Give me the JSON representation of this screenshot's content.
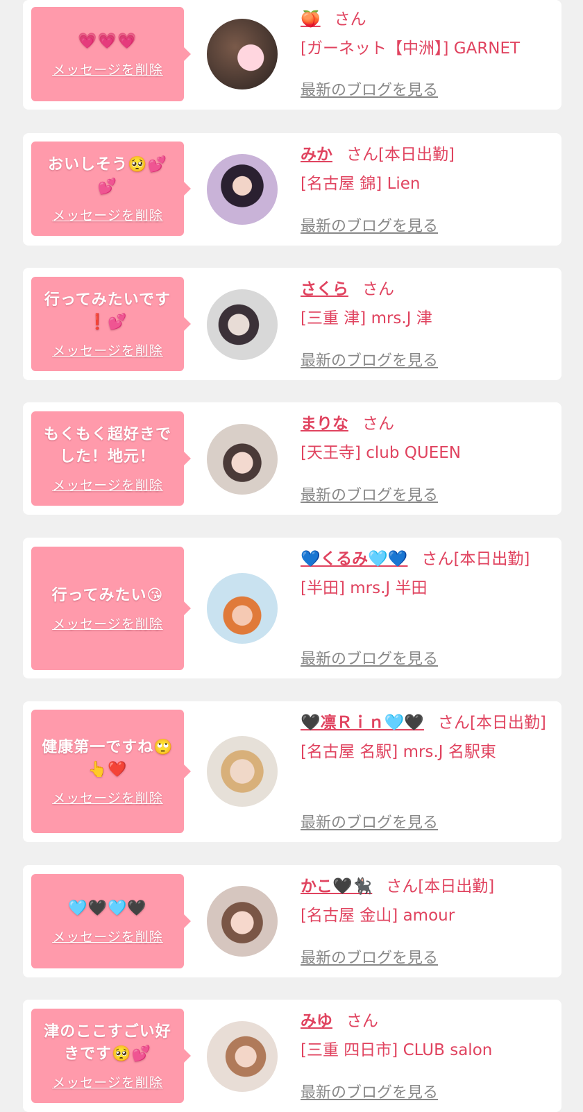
{
  "colors": {
    "accent": "#e0435f",
    "bubble": "#ff9aab",
    "background": "#f0f0f0",
    "link_gray": "#888888"
  },
  "delete_label": "メッセージを削除",
  "blog_label": "最新のブログを見る",
  "items": [
    {
      "message": "💗💗💗",
      "name": "🍑",
      "suffix": "さん",
      "shop": "[ガーネット【中洲】] GARNET"
    },
    {
      "message": "おいしそう🥺💕💕",
      "name": "みか",
      "suffix": "さん[本日出勤]",
      "shop": "[名古屋 錦] Lien"
    },
    {
      "message": "行ってみたいです❗️💕",
      "name": "さくら",
      "suffix": "さん",
      "shop": "[三重 津] mrs.J 津"
    },
    {
      "message": "もくもく超好きでした！地元！",
      "name": "まりな",
      "suffix": "さん",
      "shop": "[天王寺] club QUEEN"
    },
    {
      "message": "行ってみたい😘",
      "name": "💙くるみ🩵💙",
      "suffix": "さん[本日出勤]",
      "shop": "[半田] mrs.J 半田"
    },
    {
      "message": "健康第一ですね🙄👆❤️",
      "name": "🖤凛Ｒｉｎ🩵🖤",
      "suffix": "さん[本日出勤]",
      "shop": "[名古屋 名駅] mrs.J 名駅東"
    },
    {
      "message": "🩵🖤🩵🖤",
      "name": "かこ🖤🐈‍⬛",
      "suffix": "さん[本日出勤]",
      "shop": "[名古屋 金山] amour"
    },
    {
      "message": "津のここすごい好きです🥺💕",
      "name": "みゆ",
      "suffix": "さん",
      "shop": "[三重 四日市] CLUB salon"
    }
  ]
}
